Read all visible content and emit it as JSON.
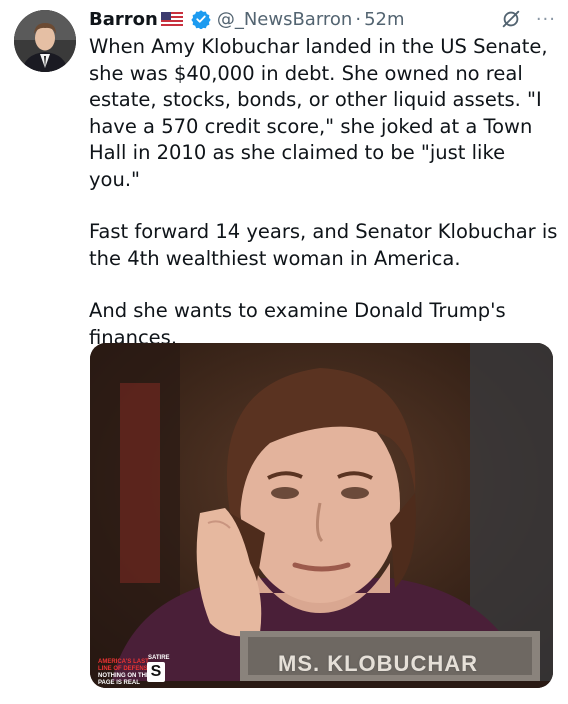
{
  "tweet": {
    "author_name": "Barron",
    "flag_icon": "us-flag-icon",
    "verified_icon": "verified-badge-icon",
    "handle": "@_NewsBarron",
    "separator": "·",
    "timestamp": "52m",
    "grok_icon": "grok-icon",
    "more_label": "···",
    "paragraphs": [
      "When Amy Klobuchar landed in the US Senate, she was $40,000 in debt. She owned no real estate, stocks, bonds, or other liquid assets. \"I have a 570 credit score,\" she joked at a Town Hall in 2010 as she claimed to be \"just like you.\"",
      "Fast forward 14 years, and Senator Klobuchar is the 4th wealthiest woman in America.",
      "And she wants to examine Donald Trump's finances."
    ],
    "media": {
      "nameplate_text": "MS. KLOBUCHAR",
      "watermark_line1": "AMERICA'S LAST",
      "watermark_line2": "LINE OF DEFENSE",
      "watermark_line3": "NOTHING ON THIS",
      "watermark_line4": "PAGE IS REAL",
      "watermark_tag": "SATIRE",
      "watermark_logo": "S"
    }
  },
  "colors": {
    "text": "#0f1419",
    "secondary": "#536471",
    "verified": "#1d9bf0"
  }
}
